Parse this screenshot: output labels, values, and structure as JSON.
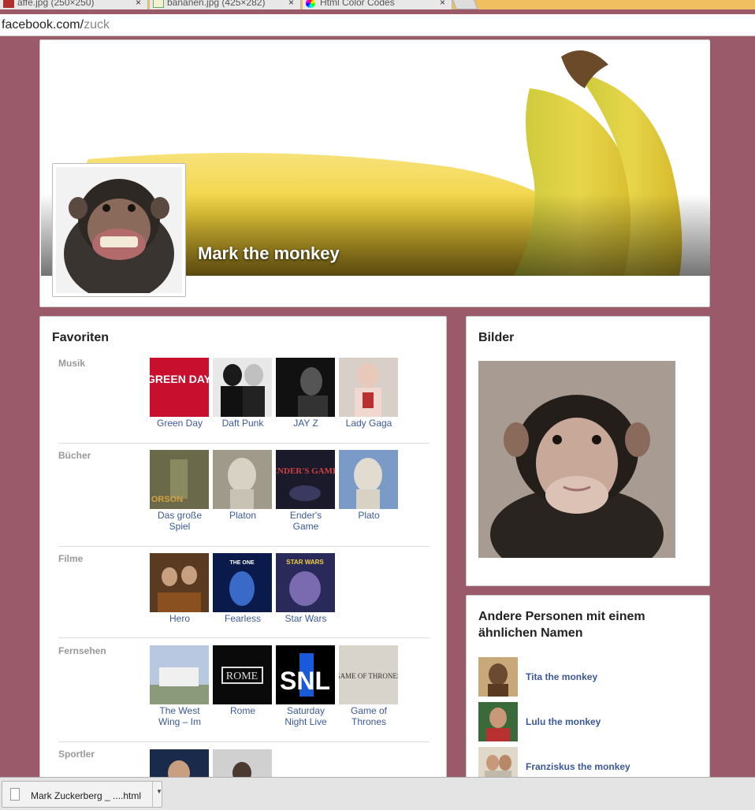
{
  "browser": {
    "tabs": [
      {
        "label": "affe.jpg (250×250)"
      },
      {
        "label": "bananen.jpg (425×282)"
      },
      {
        "label": "Html Color Codes"
      }
    ],
    "close_glyph": "×",
    "url_host": "facebook.com/",
    "url_path": "zuck"
  },
  "profile": {
    "name": "Mark the monkey"
  },
  "favorites": {
    "title": "Favoriten",
    "sections": [
      {
        "label": "Musik",
        "items": [
          "Green Day",
          "Daft Punk",
          "JAY Z",
          "Lady Gaga"
        ]
      },
      {
        "label": "Bücher",
        "items": [
          "Das große Spiel",
          "Platon",
          "Ender's Game",
          "Plato"
        ]
      },
      {
        "label": "Filme",
        "items": [
          "Hero",
          "Fearless",
          "Star Wars"
        ]
      },
      {
        "label": "Fernsehen",
        "items": [
          "The West Wing – Im",
          "Rome",
          "Saturday Night Live",
          "Game of Thrones"
        ]
      },
      {
        "label": "Sportler",
        "items": [
          "",
          ""
        ]
      }
    ],
    "thumb_text": {
      "green_day": "GREEN DAY",
      "enders_game": "ENDER'S GAME",
      "the_one": "THE ONE",
      "star_wars": "STAR WARS",
      "rome": "ROME",
      "snl": "SNL",
      "got": "GAME OF THRONES",
      "orson": "ORSON"
    }
  },
  "pictures": {
    "title": "Bilder"
  },
  "similar_people": {
    "title": "Andere Personen mit einem ähnlichen Namen",
    "people": [
      {
        "name": "Tita the monkey"
      },
      {
        "name": "Lulu the monkey"
      },
      {
        "name": "Franziskus the monkey"
      }
    ]
  },
  "downloads": {
    "file": "Mark Zuckerberg _ ....html"
  },
  "colors": {
    "page_bg": "#9b5a6a",
    "link": "#3b5998"
  }
}
